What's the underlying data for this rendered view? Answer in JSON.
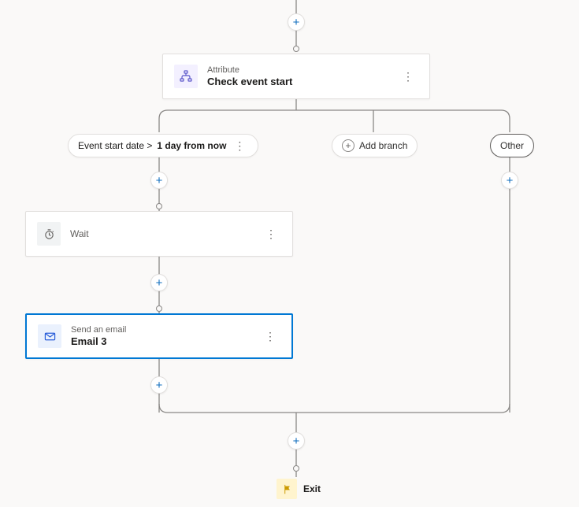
{
  "attribute_card": {
    "subtitle": "Attribute",
    "title": "Check event start",
    "icon_name": "attribute-tree-icon"
  },
  "branches": {
    "condition": {
      "prefix": "Event start date > ",
      "bold": "1 day from now"
    },
    "add_branch_label": "Add branch",
    "other_label": "Other"
  },
  "wait_card": {
    "label": "Wait",
    "icon_name": "clock-icon"
  },
  "email_card": {
    "subtitle": "Send an email",
    "title": "Email 3",
    "icon_name": "mail-icon"
  },
  "exit": {
    "label": "Exit",
    "icon_name": "flag-icon"
  },
  "add_button_glyph": "+",
  "more_glyph": "⋮"
}
